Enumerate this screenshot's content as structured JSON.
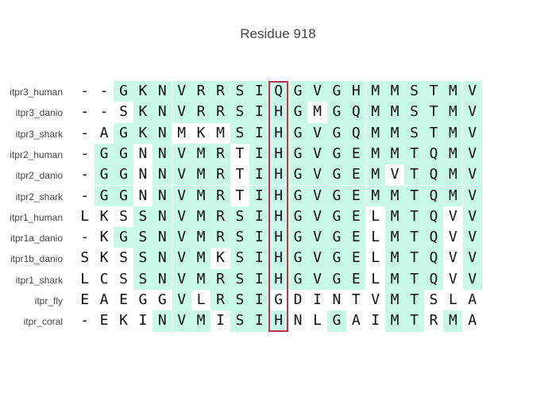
{
  "title": "Residue 918",
  "colors": {
    "conserved_bg": "#c8f8e8",
    "highlight_border": "#c0304a",
    "text": "#111111"
  },
  "highlight_column": 10,
  "rows": [
    {
      "name": "itpr3_human",
      "residues": [
        "-",
        "-",
        "G",
        "K",
        "N",
        "V",
        "R",
        "R",
        "S",
        "I",
        "Q",
        "G",
        "V",
        "G",
        "H",
        "M",
        "M",
        "S",
        "T",
        "M",
        "V"
      ],
      "shaded": [
        0,
        0,
        1,
        1,
        1,
        1,
        1,
        1,
        1,
        1,
        1,
        1,
        1,
        1,
        1,
        1,
        1,
        1,
        1,
        1,
        1
      ]
    },
    {
      "name": "itpr3_danio",
      "residues": [
        "-",
        "-",
        "S",
        "K",
        "N",
        "V",
        "R",
        "R",
        "S",
        "I",
        "H",
        "G",
        "M",
        "G",
        "Q",
        "M",
        "M",
        "S",
        "T",
        "M",
        "V"
      ],
      "shaded": [
        0,
        0,
        0,
        1,
        1,
        1,
        1,
        1,
        1,
        1,
        1,
        1,
        0,
        1,
        1,
        1,
        1,
        1,
        1,
        1,
        1
      ]
    },
    {
      "name": "itpr3_shark",
      "residues": [
        "-",
        "A",
        "G",
        "K",
        "N",
        "M",
        "K",
        "M",
        "S",
        "I",
        "H",
        "G",
        "V",
        "G",
        "Q",
        "M",
        "M",
        "S",
        "T",
        "M",
        "V"
      ],
      "shaded": [
        0,
        0,
        1,
        1,
        1,
        0,
        0,
        0,
        1,
        1,
        1,
        1,
        1,
        1,
        1,
        1,
        1,
        1,
        1,
        1,
        1
      ]
    },
    {
      "name": "itpr2_human",
      "residues": [
        "-",
        "G",
        "G",
        "N",
        "N",
        "V",
        "M",
        "R",
        "T",
        "I",
        "H",
        "G",
        "V",
        "G",
        "E",
        "M",
        "M",
        "T",
        "Q",
        "M",
        "V"
      ],
      "shaded": [
        0,
        1,
        1,
        0,
        1,
        1,
        1,
        1,
        0,
        1,
        1,
        1,
        1,
        1,
        1,
        1,
        1,
        1,
        1,
        1,
        1
      ]
    },
    {
      "name": "itpr2_danio",
      "residues": [
        "-",
        "G",
        "G",
        "N",
        "N",
        "V",
        "M",
        "R",
        "T",
        "I",
        "H",
        "G",
        "V",
        "G",
        "E",
        "M",
        "V",
        "T",
        "Q",
        "M",
        "V"
      ],
      "shaded": [
        0,
        1,
        1,
        0,
        1,
        1,
        1,
        1,
        0,
        1,
        1,
        1,
        1,
        1,
        1,
        1,
        0,
        1,
        1,
        1,
        1
      ]
    },
    {
      "name": "itpr2_shark",
      "residues": [
        "-",
        "G",
        "G",
        "N",
        "N",
        "V",
        "M",
        "R",
        "T",
        "I",
        "H",
        "G",
        "V",
        "G",
        "E",
        "M",
        "M",
        "T",
        "Q",
        "M",
        "V"
      ],
      "shaded": [
        0,
        1,
        1,
        0,
        1,
        1,
        1,
        1,
        0,
        1,
        1,
        1,
        1,
        1,
        1,
        1,
        1,
        1,
        1,
        1,
        1
      ]
    },
    {
      "name": "itpr1_human",
      "residues": [
        "L",
        "K",
        "S",
        "S",
        "N",
        "V",
        "M",
        "R",
        "S",
        "I",
        "H",
        "G",
        "V",
        "G",
        "E",
        "L",
        "M",
        "T",
        "Q",
        "V",
        "V"
      ],
      "shaded": [
        0,
        0,
        0,
        1,
        1,
        1,
        1,
        1,
        1,
        1,
        1,
        1,
        1,
        1,
        1,
        0,
        1,
        1,
        1,
        0,
        1
      ]
    },
    {
      "name": "itpr1a_danio",
      "residues": [
        "-",
        "K",
        "G",
        "S",
        "N",
        "V",
        "M",
        "R",
        "S",
        "I",
        "H",
        "G",
        "V",
        "G",
        "E",
        "L",
        "M",
        "T",
        "Q",
        "V",
        "V"
      ],
      "shaded": [
        0,
        0,
        1,
        1,
        1,
        1,
        1,
        1,
        1,
        1,
        1,
        1,
        1,
        1,
        1,
        0,
        1,
        1,
        1,
        0,
        1
      ]
    },
    {
      "name": "itpr1b_danio",
      "residues": [
        "S",
        "K",
        "S",
        "S",
        "N",
        "V",
        "M",
        "K",
        "S",
        "I",
        "H",
        "G",
        "V",
        "G",
        "E",
        "L",
        "M",
        "T",
        "Q",
        "V",
        "V"
      ],
      "shaded": [
        0,
        0,
        0,
        1,
        1,
        1,
        1,
        0,
        1,
        1,
        1,
        1,
        1,
        1,
        1,
        0,
        1,
        1,
        1,
        0,
        1
      ]
    },
    {
      "name": "itpr1_shark",
      "residues": [
        "L",
        "C",
        "S",
        "S",
        "N",
        "V",
        "M",
        "R",
        "S",
        "I",
        "H",
        "G",
        "V",
        "G",
        "E",
        "L",
        "M",
        "T",
        "Q",
        "V",
        "V"
      ],
      "shaded": [
        0,
        0,
        0,
        1,
        1,
        1,
        1,
        1,
        1,
        1,
        1,
        1,
        1,
        1,
        1,
        0,
        1,
        1,
        1,
        0,
        1
      ]
    },
    {
      "name": "itpr_fly",
      "residues": [
        "E",
        "A",
        "E",
        "G",
        "G",
        "V",
        "L",
        "R",
        "S",
        "I",
        "G",
        "D",
        "I",
        "N",
        "T",
        "V",
        "M",
        "T",
        "S",
        "L",
        "A"
      ],
      "shaded": [
        0,
        0,
        0,
        0,
        0,
        1,
        0,
        1,
        1,
        1,
        0,
        0,
        0,
        0,
        0,
        0,
        1,
        1,
        0,
        0,
        0
      ]
    },
    {
      "name": "itpr_coral",
      "residues": [
        "-",
        "E",
        "K",
        "I",
        "N",
        "V",
        "M",
        "I",
        "S",
        "I",
        "H",
        "N",
        "L",
        "G",
        "A",
        "I",
        "M",
        "T",
        "R",
        "M",
        "A"
      ],
      "shaded": [
        0,
        0,
        0,
        0,
        1,
        1,
        1,
        0,
        1,
        1,
        1,
        0,
        0,
        1,
        0,
        0,
        1,
        1,
        0,
        1,
        0
      ]
    }
  ]
}
